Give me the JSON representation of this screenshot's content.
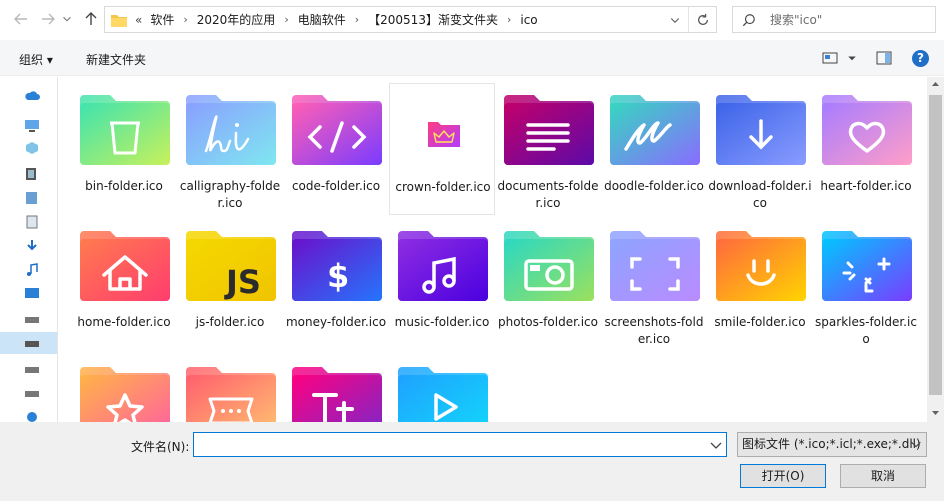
{
  "address": {
    "overflow": "«",
    "crumbs": [
      "软件",
      "2020年的应用",
      "电脑软件",
      "【200513】渐变文件夹",
      "ico"
    ]
  },
  "search": {
    "placeholder": "搜索\"ico\""
  },
  "toolbar": {
    "organize": "组织 ▾",
    "new_folder": "新建文件夹",
    "help": "?"
  },
  "files": [
    {
      "name": "bin-folder.ico",
      "icon": "bin-icon",
      "colors": [
        "#3fe3b0",
        "#c8f15a"
      ]
    },
    {
      "name": "calligraphy-folder.ico",
      "icon": "calligraphy-hi-icon",
      "colors": [
        "#8aa0ff",
        "#7fe7f0"
      ]
    },
    {
      "name": "code-folder.ico",
      "icon": "code-icon",
      "colors": [
        "#ff5fb4",
        "#7a3cff"
      ]
    },
    {
      "name": "crown-folder.ico",
      "icon": "crown-icon",
      "colors": [
        "#ff3d7f",
        "#b23cff"
      ]
    },
    {
      "name": "documents-folder.ico",
      "icon": "documents-icon",
      "colors": [
        "#c2006a",
        "#5c0aa8"
      ]
    },
    {
      "name": "doodle-folder.ico",
      "icon": "doodle-icon",
      "colors": [
        "#36d6c0",
        "#8a6cff"
      ]
    },
    {
      "name": "download-folder.ico",
      "icon": "download-icon",
      "colors": [
        "#3c64e8",
        "#8a9cff"
      ]
    },
    {
      "name": "heart-folder.ico",
      "icon": "heart-icon",
      "colors": [
        "#a77cff",
        "#ff9ec8"
      ]
    },
    {
      "name": "home-folder.ico",
      "icon": "home-icon",
      "colors": [
        "#ff7a4f",
        "#ff3d6e"
      ]
    },
    {
      "name": "js-folder.ico",
      "icon": "js-icon",
      "colors": [
        "#f5d800",
        "#f0c400"
      ]
    },
    {
      "name": "money-folder.ico",
      "icon": "money-icon",
      "colors": [
        "#6a11cb",
        "#2575fc"
      ]
    },
    {
      "name": "music-folder.ico",
      "icon": "music-icon",
      "colors": [
        "#8e2de2",
        "#4a00e0"
      ]
    },
    {
      "name": "photos-folder.ico",
      "icon": "camera-icon",
      "colors": [
        "#2bd8c2",
        "#9be15d"
      ]
    },
    {
      "name": "screenshots-folder.ico",
      "icon": "screenshot-frame-icon",
      "colors": [
        "#8ea4ff",
        "#b98bff"
      ]
    },
    {
      "name": "smile-folder.ico",
      "icon": "smile-icon",
      "colors": [
        "#ff6a3d",
        "#ffd400"
      ]
    },
    {
      "name": "sparkles-folder.ico",
      "icon": "sparkles-icon",
      "colors": [
        "#00c6ff",
        "#7a3cff"
      ]
    },
    {
      "name": "",
      "icon": "star-icon",
      "colors": [
        "#ffb347",
        "#ff5fa2"
      ]
    },
    {
      "name": "",
      "icon": "ellipsis-frame-icon",
      "colors": [
        "#ff5f6d",
        "#ffc371"
      ]
    },
    {
      "name": "",
      "icon": "text-icon",
      "colors": [
        "#ff0080",
        "#7928ca"
      ]
    },
    {
      "name": "",
      "icon": "play-icon",
      "colors": [
        "#1fa2ff",
        "#12d8fa"
      ]
    }
  ],
  "bottom": {
    "filename_label": "文件名(N):",
    "filename_value": "",
    "filter": "图标文件 (*.ico;*.icl;*.exe;*.dll)",
    "open": "打开(O)",
    "cancel": "取消"
  }
}
